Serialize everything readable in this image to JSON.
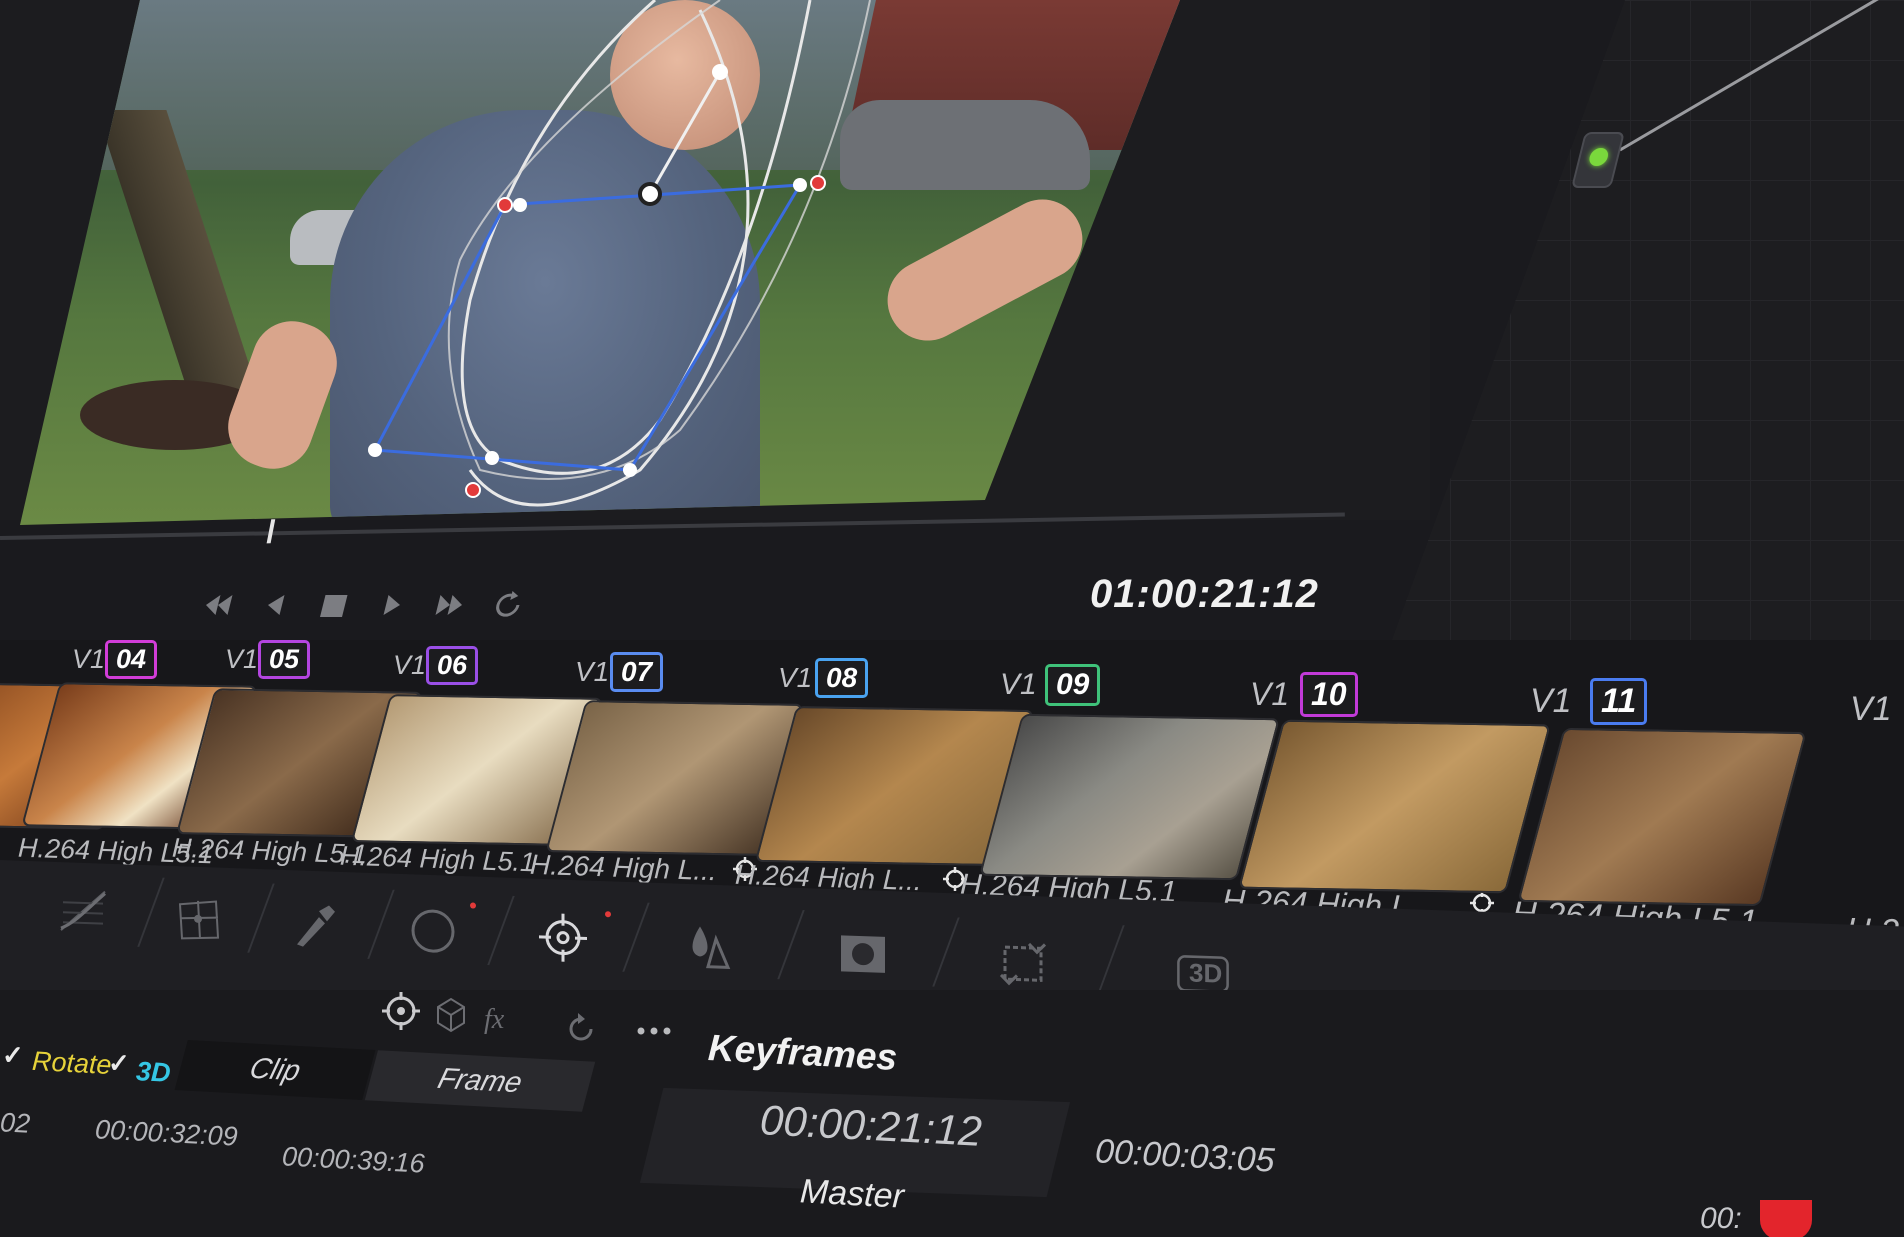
{
  "viewer": {
    "timecode": "01:00:21:12",
    "transport": [
      {
        "name": "go-to-first-frame-button",
        "icon": "skip-back-icon"
      },
      {
        "name": "play-reverse-button",
        "icon": "play-reverse-icon"
      },
      {
        "name": "stop-button",
        "icon": "stop-icon"
      },
      {
        "name": "play-button",
        "icon": "play-icon"
      },
      {
        "name": "go-to-last-frame-button",
        "icon": "skip-forward-icon"
      },
      {
        "name": "loop-button",
        "icon": "loop-icon"
      }
    ],
    "playhead_fraction": 0.2
  },
  "nodes": {
    "node_color": "#7ad83c"
  },
  "clips": [
    {
      "track": "V1",
      "number": "04",
      "color": "#d23dd8",
      "codec": "H.264 High L5.1",
      "fx": false
    },
    {
      "track": "V1",
      "number": "05",
      "color": "#b445e0",
      "codec": "H.264 High L5.1",
      "fx": false
    },
    {
      "track": "V1",
      "number": "06",
      "color": "#9a4fe6",
      "codec": "H.264 High L5.1",
      "fx": false
    },
    {
      "track": "V1",
      "number": "07",
      "color": "#5a8cf0",
      "codec": "H.264 High L...",
      "fx": true
    },
    {
      "track": "V1",
      "number": "08",
      "color": "#4aa3f0",
      "codec": "H.264 High L...",
      "fx": true
    },
    {
      "track": "V1",
      "number": "09",
      "color": "#3fc27a",
      "codec": "H.264 High L5.1",
      "fx": false
    },
    {
      "track": "V1",
      "number": "10",
      "color": "#c23ad8",
      "codec": "H.264 High L...",
      "fx": true
    },
    {
      "track": "V1",
      "number": "11",
      "color": "#4a7cf0",
      "codec": "H.264 High L5.1",
      "fx": false
    },
    {
      "track": "V1",
      "number": "",
      "color": "#2c2c30",
      "codec": "H.2",
      "fx": false
    }
  ],
  "palette": {
    "tools": [
      "curves-icon",
      "warp-icon",
      "qualifier-icon",
      "window-icon",
      "tracker-icon",
      "blur-icon",
      "key-icon",
      "sizing-icon",
      "3d-icon"
    ],
    "tool_3d_label": "3D"
  },
  "tracker": {
    "rotate_label": "Rotate",
    "label_3d": "3D",
    "segments": [
      "Clip",
      "Frame"
    ],
    "keyframes_title": "Keyframes",
    "timecodes": [
      "02",
      "00:00:32:09",
      "00:00:39:16"
    ],
    "current_timecode": "00:00:21:12",
    "mode_label": "Master",
    "duration_timecode": "00:00:03:05",
    "partial_timecode": "00:"
  }
}
